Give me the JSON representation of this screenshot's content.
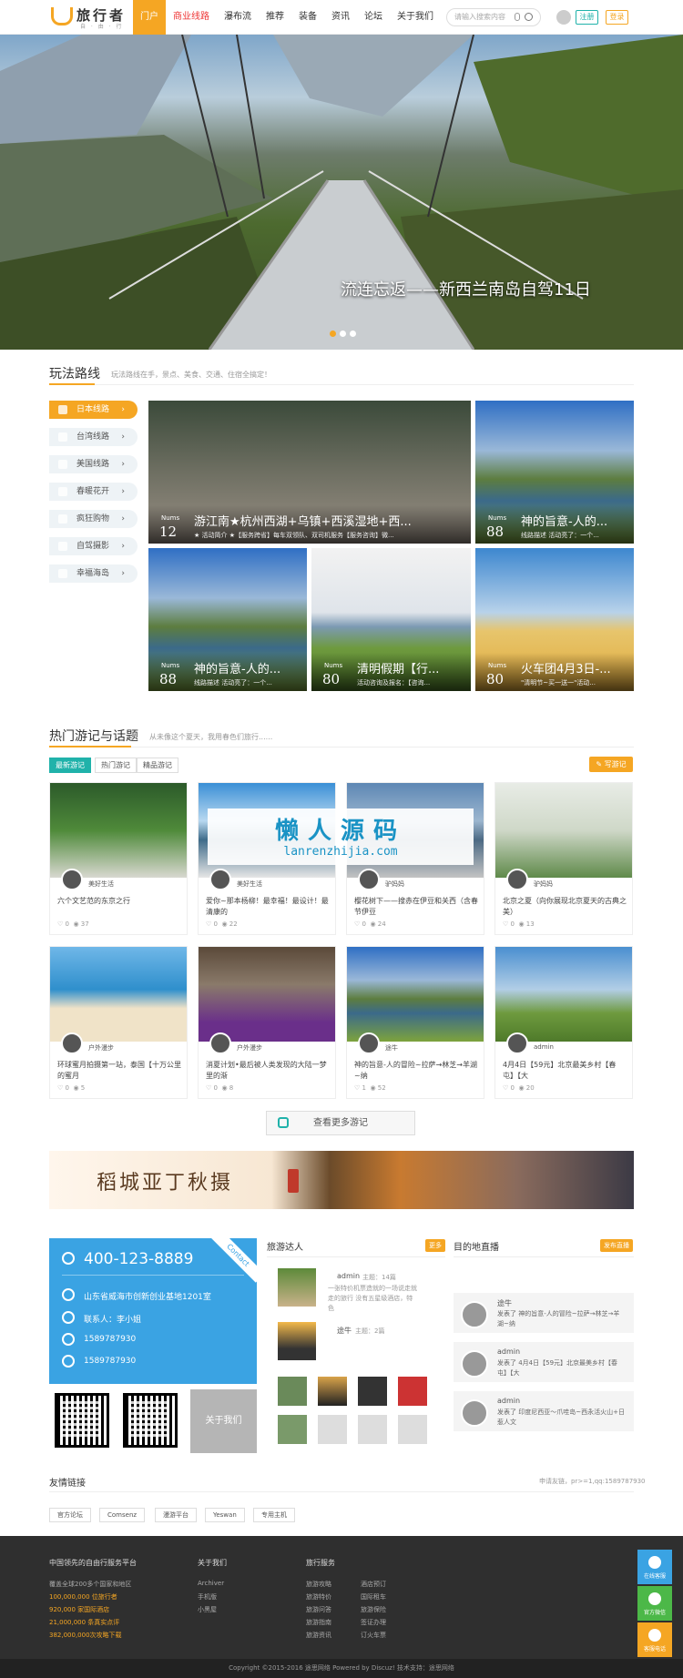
{
  "header": {
    "logo_title": "旅行者",
    "logo_sub": "自 · 由 · 行",
    "nav": [
      "门户",
      "商业线路",
      "瀑布流",
      "推荐",
      "装备",
      "资讯",
      "论坛",
      "关于我们"
    ],
    "search_placeholder": "请输入搜索内容",
    "register": "注册",
    "login": "登录"
  },
  "banner": {
    "caption": "流连忘返——新西兰南岛自驾11日"
  },
  "routes": {
    "title": "玩法路线",
    "subtitle": "玩法路线在手，景点、美食、交通、住宿全搞定！",
    "menu": [
      "日本线路",
      "台湾线路",
      "美国线路",
      "春暖花开",
      "疯狂购物",
      "自驾摄影",
      "幸福海岛"
    ],
    "nums_label": "Nums",
    "items": [
      {
        "num": "12",
        "title": "游江南★杭州西湖+乌镇+西溪湿地+西...",
        "desc": "★ 活动简介 ★【服务跨省】每车双领队、双司机服务【服务咨询】微..."
      },
      {
        "num": "88",
        "title": "神的旨意-人的...",
        "desc": "线路描述 活动亮了：一个..."
      },
      {
        "num": "88",
        "title": "神的旨意-人的...",
        "desc": "线路描述 活动亮了：一个..."
      },
      {
        "num": "80",
        "title": "清明假期【行...",
        "desc": "活动咨询及报名：【咨询..."
      },
      {
        "num": "80",
        "title": "火车团4月3日-...",
        "desc": "\"清明节~买一送一\"活动..."
      }
    ]
  },
  "journals": {
    "title": "热门游记与话题",
    "subtitle": "从未像这个夏天，我用春色们旅行......",
    "tabs": [
      "最新游记",
      "热门游记",
      "精品游记"
    ],
    "write": "写游记",
    "cards": [
      {
        "author": "美好生活",
        "title": "六个文艺范的东京之行",
        "likes": "0",
        "views": "37"
      },
      {
        "author": "美好生活",
        "title": "爱你~那本杨柳！最幸福！最设计！最清康的",
        "likes": "0",
        "views": "22"
      },
      {
        "author": "驴妈妈",
        "title": "樱花树下——搜赤在伊豆和关西（含春节伊豆",
        "likes": "0",
        "views": "24"
      },
      {
        "author": "驴妈妈",
        "title": "北京之夏（向你展现北京夏天的古典之美）",
        "likes": "0",
        "views": "13"
      },
      {
        "author": "户外漫步",
        "title": "环球蜜月拍摄第一站，泰国【十万公里的蜜月",
        "likes": "0",
        "views": "5"
      },
      {
        "author": "户外漫步",
        "title": "消夏计划•最后被人类发现的大陆一梦里的渐",
        "likes": "0",
        "views": "8"
      },
      {
        "author": "途牛",
        "title": "神的旨意-人的冒险~拉萨→林芝→羊湖~纳",
        "likes": "1",
        "views": "52"
      },
      {
        "author": "admin",
        "title": "4月4日【59元】北京最美乡村【春屯】【大",
        "likes": "0",
        "views": "20"
      }
    ],
    "more": "查看更多游记"
  },
  "ad": {
    "title": "稻城亚丁秋摄"
  },
  "watermark": {
    "cn": "懒人源码",
    "en": "lanrenzhijia.com"
  },
  "contact": {
    "phone": "400-123-8889",
    "ribbon": "Contact",
    "address": "山东省威海市创新创业基地1201室",
    "person": "联系人：李小姐",
    "qq1": "1589787930",
    "qq2": "1589787930",
    "about": "关于我们"
  },
  "people": {
    "title": "旅游达人",
    "badge": "更多",
    "p1": {
      "name": "admin",
      "level": "主题：14篇",
      "desc": "一张特价机票造就的一场说走就走的旅行 没有五星级酒店，特色"
    },
    "p2": {
      "name": "途牛",
      "level": "主题：2篇"
    }
  },
  "live": {
    "title": "目的地直播",
    "badge": "发布直播",
    "items": [
      {
        "name": "途牛",
        "text": "发表了 神的旨意-人的冒险~拉萨→林芝→羊湖~纳"
      },
      {
        "name": "admin",
        "text": "发表了 4月4日【59元】北京最美乡村【春屯】【大"
      },
      {
        "name": "admin",
        "text": "发表了 印度尼西亚～爪哇岛~西永活火山+日惹人文"
      }
    ]
  },
  "links": {
    "title": "友情链接",
    "apply": "申请友链，pr>=1,qq:1589787930",
    "items": [
      "官方论坛",
      "Comsenz",
      "漫游平台",
      "Yeswan",
      "专用主机"
    ]
  },
  "footer": {
    "col1_title": "中国领先的自由行服务平台",
    "col1": [
      {
        "v": "覆盖全球200多个国家和地区",
        "o": false
      },
      {
        "v": "100,000,000 位旅行者",
        "o": true
      },
      {
        "v": "920,000 家国际酒店",
        "o": true
      },
      {
        "v": "21,000,000 条真实点评",
        "o": true
      },
      {
        "v": "382,000,000次攻略下载",
        "o": true
      }
    ],
    "col2_title": "关于我们",
    "col2": [
      "Archiver",
      "手机版",
      "小黑屋"
    ],
    "col3_title": "旅行服务",
    "col3a": [
      "旅游攻略",
      "旅游特价",
      "旅游问答",
      "旅游指南",
      "旅游资讯"
    ],
    "col3b": [
      "酒店预订",
      "国际租车",
      "旅游保险",
      "签证办理",
      "订火车票"
    ],
    "copyright": "Copyright ©2015-2016 途思网络 Powered by Discuz! 技术支持：途思网络"
  },
  "side": {
    "b1": "在线客服",
    "b2": "官方微信",
    "b3": "客服电话"
  },
  "colors": {
    "accent": "#f5a623",
    "teal": "#20b2aa",
    "blue": "#3aa3e3"
  }
}
